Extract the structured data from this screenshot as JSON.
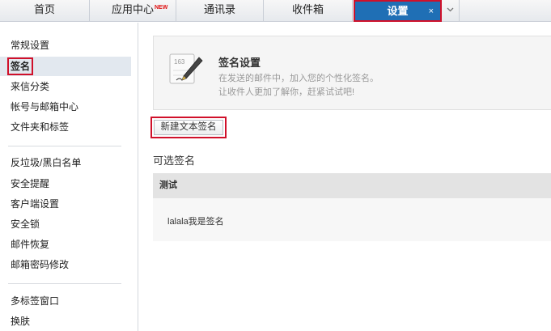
{
  "tabs": [
    {
      "label": "首页"
    },
    {
      "label": "应用中心",
      "badge": "NEW"
    },
    {
      "label": "通讯录"
    },
    {
      "label": "收件箱"
    },
    {
      "label": "设置",
      "close": "×"
    }
  ],
  "sidebar": {
    "groups": [
      [
        "常规设置",
        "签名",
        "来信分类",
        "帐号与邮箱中心",
        "文件夹和标签"
      ],
      [
        "反垃圾/黑白名单",
        "安全提醒",
        "客户端设置",
        "安全锁",
        "邮件恢复",
        "邮箱密码修改"
      ],
      [
        "多标签窗口",
        "换肤"
      ]
    ],
    "selected": "签名"
  },
  "info": {
    "icon": "signature-pen-icon",
    "title": "签名设置",
    "desc1": "在发送的邮件中，加入您的个性化签名。",
    "desc2": "让收件人更加了解你，赶紧试试吧!"
  },
  "new_button": "新建文本签名",
  "section_label": "可选签名",
  "signature": {
    "name": "测试",
    "content": "lalala我是签名"
  },
  "colors": {
    "active_tab": "#1f6fb5",
    "highlight": "#d0102a"
  }
}
